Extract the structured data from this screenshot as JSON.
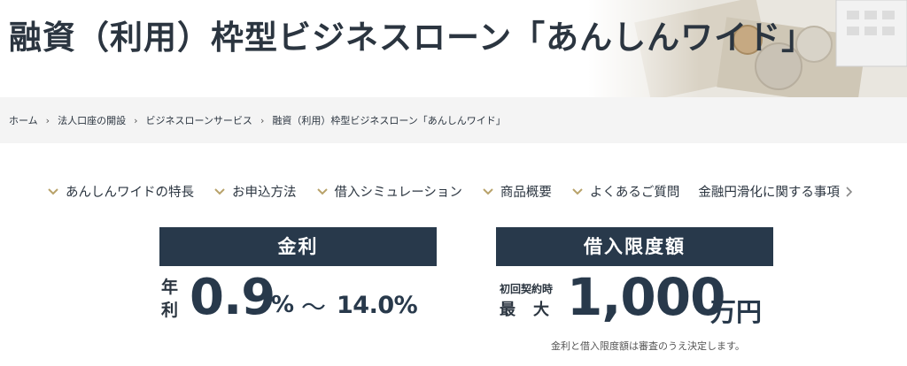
{
  "header": {
    "title": "融資（利用）枠型ビジネスローン「あんしんワイド」"
  },
  "breadcrumb": {
    "items": [
      "ホーム",
      "法人口座の開設",
      "ビジネスローンサービス",
      "融資（利用）枠型ビジネスローン「あんしんワイド」"
    ],
    "separator": "›"
  },
  "anchor_nav": {
    "items": [
      "あんしんワイドの特長",
      "お申込方法",
      "借入シミュレーション",
      "商品概要",
      "よくあるご質問",
      "金融円滑化に関する事項"
    ]
  },
  "rate_panel": {
    "heading": "金利",
    "label": "年利",
    "min": "0.9",
    "min_unit": "%",
    "range_sep": "～",
    "max": "14.0%"
  },
  "limit_panel": {
    "heading": "借入限度額",
    "pre_label": "初回契約時",
    "label": "最大",
    "value": "1,000",
    "unit": "万円"
  },
  "footnote": "金利と借入限度額は審査のうえ決定します。",
  "colors": {
    "navy": "#28394b",
    "text": "#2b3540",
    "chevron": "#b8a26a",
    "breadcrumb_bg": "#f4f4f4"
  }
}
